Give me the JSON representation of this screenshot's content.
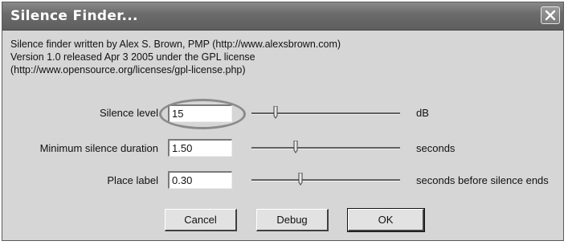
{
  "window": {
    "title": "Silence Finder..."
  },
  "about": {
    "line1": "Silence finder written by Alex S. Brown, PMP (http://www.alexsbrown.com)",
    "line2": "Version 1.0 released Apr 3 2005 under the GPL license",
    "line3": "(http://www.opensource.org/licenses/gpl-license.php)"
  },
  "rows": [
    {
      "label": "Silence level",
      "value": "15",
      "unit": "dB"
    },
    {
      "label": "Minimum silence duration",
      "value": "1.50",
      "unit": "seconds"
    },
    {
      "label": "Place label",
      "value": "0.30",
      "unit": "seconds before silence ends"
    }
  ],
  "buttons": {
    "cancel": "Cancel",
    "debug": "Debug",
    "ok": "OK"
  },
  "icons": {
    "close": "close-icon",
    "slider_thumb": "slider-thumb"
  }
}
